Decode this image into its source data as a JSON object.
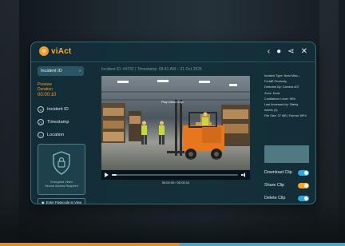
{
  "app": {
    "logo_text": "viAct",
    "logo_icon": "viact-logo-icon"
  },
  "topbar_icons": [
    "chevron-left-icon",
    "user-icon",
    "share-icon",
    "close-icon"
  ],
  "sidebar": {
    "incident_select": {
      "label": "Incident ID",
      "icon": "chevron-right-icon"
    },
    "duration_label_line1": "Preview",
    "duration_label_line2": "Duration",
    "duration_value": "00:00:10",
    "menu": [
      {
        "label": "Incident ID",
        "icon": "id-icon"
      },
      {
        "label": "Timestamp",
        "icon": "clock-icon"
      },
      {
        "label": "Location",
        "icon": "location-icon"
      }
    ],
    "lock_card": {
      "icon": "shield-lock-icon",
      "line1": "Encrypted Video",
      "line2": "Secure Access Required"
    },
    "passcode_button": "Enter Passcode to View"
  },
  "video_meta": "Incident ID: #4732 | Timestamp: 09:41 AM – 21 Oct 2025",
  "video": {
    "overlay_label": "Play Demo Clip",
    "progress": 0.04,
    "timecode": "00:00:00 / 00:00:10"
  },
  "details": {
    "lines": [
      "Incident Type: Near Miss –",
      "Forklift Proximity",
      "Detected By: Camera #07",
      "Zone: Dock",
      "Confidence Level: 96%",
      "Last Accessed by: Safety",
      "Admin (3)",
      "File Size: 37 MB | Format: MP4"
    ]
  },
  "actions": [
    {
      "label": "Download Clip",
      "on": true,
      "color": "#2ea6e0"
    },
    {
      "label": "Share Clip",
      "on": true,
      "color": "#f5a623"
    },
    {
      "label": "Delete Clip",
      "on": true,
      "color": "#2ea6e0"
    }
  ],
  "colors": {
    "accent_orange": "#f39a30",
    "accent_blue": "#2ea6e0",
    "panel": "#12303a"
  }
}
